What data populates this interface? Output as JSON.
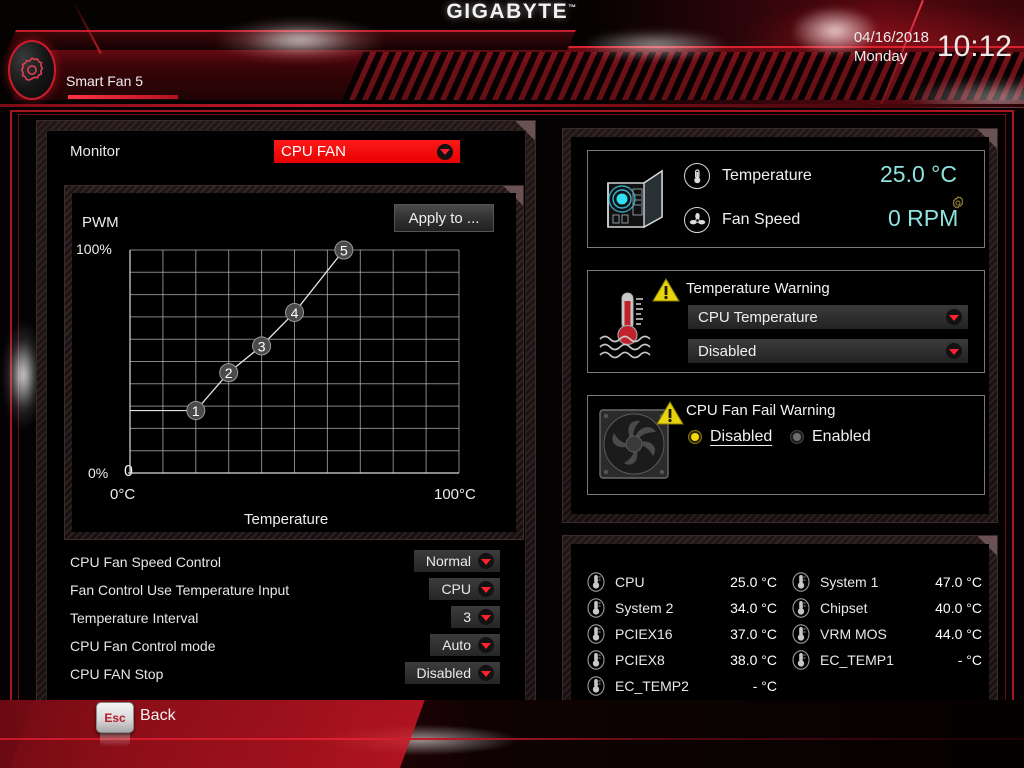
{
  "header": {
    "brand": "GIGABYTE",
    "brand_tm": "™",
    "page_title": "Smart Fan 5",
    "date": "04/16/2018",
    "weekday": "Monday",
    "time": "10:12",
    "logo_icon": "gear-icon"
  },
  "left": {
    "monitor_label": "Monitor",
    "monitor_value": "CPU FAN",
    "apply_button": "Apply to ...",
    "graph": {
      "pwm_label": "PWM",
      "y_max": "100%",
      "y_min": "0%",
      "origin": "0",
      "x_min": "0°C",
      "x_max": "100°C",
      "x_title": "Temperature"
    },
    "settings": [
      {
        "name": "CPU Fan Speed Control",
        "value": "Normal"
      },
      {
        "name": "Fan Control Use Temperature Input",
        "value": "CPU"
      },
      {
        "name": "Temperature Interval",
        "value": "3"
      },
      {
        "name": "CPU Fan Control mode",
        "value": "Auto"
      },
      {
        "name": "CPU FAN Stop",
        "value": "Disabled"
      }
    ]
  },
  "right": {
    "monitor_box": {
      "case_icon": "pc-case-icon",
      "temperature_label": "Temperature",
      "temperature_value": "25.0 °C",
      "fan_speed_label": "Fan Speed",
      "fan_speed_value": "0 RPM",
      "temperature_icon": "thermometer-icon",
      "fan_icon": "fan-icon",
      "gear_badge_icon": "gear-icon"
    },
    "temp_warning": {
      "title": "Temperature Warning",
      "warning_icon": "warning-triangle-icon",
      "thermometer_icon": "thermometer-water-icon",
      "source_value": "CPU Temperature",
      "state_value": "Disabled"
    },
    "fan_warning": {
      "title": "CPU Fan Fail Warning",
      "warning_icon": "warning-triangle-icon",
      "fan_icon": "case-fan-icon",
      "option_disabled": "Disabled",
      "option_enabled": "Enabled",
      "selected": "Disabled"
    },
    "sensors": [
      {
        "name": "CPU",
        "value": "25.0 °C"
      },
      {
        "name": "System 1",
        "value": "47.0 °C"
      },
      {
        "name": "System 2",
        "value": "34.0 °C"
      },
      {
        "name": "Chipset",
        "value": "40.0 °C"
      },
      {
        "name": "PCIEX16",
        "value": "37.0 °C"
      },
      {
        "name": "VRM MOS",
        "value": "44.0 °C"
      },
      {
        "name": "PCIEX8",
        "value": "38.0 °C"
      },
      {
        "name": "EC_TEMP1",
        "value": "- °C"
      },
      {
        "name": "EC_TEMP2",
        "value": "- °C"
      }
    ]
  },
  "footer": {
    "key": "Esc",
    "label": "Back"
  },
  "colors": {
    "accent_red": "#e60000",
    "frame_red": "#a8141f",
    "value_cyan": "#8fe3df",
    "warning_yellow": "#f5d908",
    "grid_line": "#b9b9b9"
  },
  "chart_data": {
    "type": "line",
    "title": "PWM vs Temperature fan curve",
    "xlabel": "Temperature",
    "ylabel": "PWM",
    "xlim": [
      0,
      100
    ],
    "ylim": [
      0,
      100
    ],
    "xtick_labels": [
      "0°C",
      "100°C"
    ],
    "ytick_labels": [
      "0%",
      "100%"
    ],
    "grid": true,
    "grid_cols": 10,
    "grid_rows": 10,
    "point_labels": [
      "1",
      "2",
      "3",
      "4",
      "5"
    ],
    "x": [
      20,
      30,
      40,
      50,
      65
    ],
    "y": [
      28,
      45,
      57,
      72,
      100
    ],
    "series": [
      {
        "name": "CPU FAN curve",
        "points": [
          {
            "label": "1",
            "temp": 20,
            "pwm": 28
          },
          {
            "label": "2",
            "temp": 30,
            "pwm": 45
          },
          {
            "label": "3",
            "temp": 40,
            "pwm": 57
          },
          {
            "label": "4",
            "temp": 50,
            "pwm": 72
          },
          {
            "label": "5",
            "temp": 65,
            "pwm": 100
          }
        ]
      }
    ]
  }
}
